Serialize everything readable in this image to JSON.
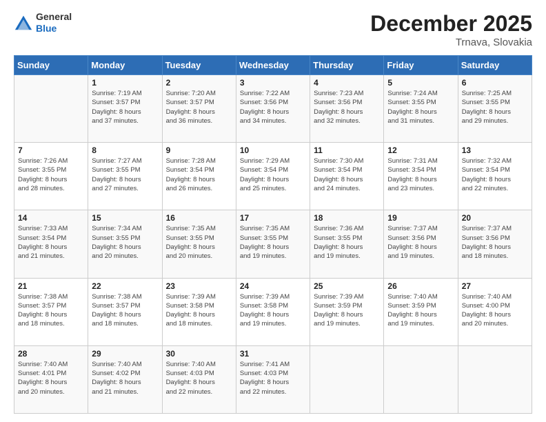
{
  "header": {
    "logo_general": "General",
    "logo_blue": "Blue",
    "month_year": "December 2025",
    "location": "Trnava, Slovakia"
  },
  "weekdays": [
    "Sunday",
    "Monday",
    "Tuesday",
    "Wednesday",
    "Thursday",
    "Friday",
    "Saturday"
  ],
  "weeks": [
    [
      {
        "day": "",
        "info": ""
      },
      {
        "day": "1",
        "info": "Sunrise: 7:19 AM\nSunset: 3:57 PM\nDaylight: 8 hours\nand 37 minutes."
      },
      {
        "day": "2",
        "info": "Sunrise: 7:20 AM\nSunset: 3:57 PM\nDaylight: 8 hours\nand 36 minutes."
      },
      {
        "day": "3",
        "info": "Sunrise: 7:22 AM\nSunset: 3:56 PM\nDaylight: 8 hours\nand 34 minutes."
      },
      {
        "day": "4",
        "info": "Sunrise: 7:23 AM\nSunset: 3:56 PM\nDaylight: 8 hours\nand 32 minutes."
      },
      {
        "day": "5",
        "info": "Sunrise: 7:24 AM\nSunset: 3:55 PM\nDaylight: 8 hours\nand 31 minutes."
      },
      {
        "day": "6",
        "info": "Sunrise: 7:25 AM\nSunset: 3:55 PM\nDaylight: 8 hours\nand 29 minutes."
      }
    ],
    [
      {
        "day": "7",
        "info": "Sunrise: 7:26 AM\nSunset: 3:55 PM\nDaylight: 8 hours\nand 28 minutes."
      },
      {
        "day": "8",
        "info": "Sunrise: 7:27 AM\nSunset: 3:55 PM\nDaylight: 8 hours\nand 27 minutes."
      },
      {
        "day": "9",
        "info": "Sunrise: 7:28 AM\nSunset: 3:54 PM\nDaylight: 8 hours\nand 26 minutes."
      },
      {
        "day": "10",
        "info": "Sunrise: 7:29 AM\nSunset: 3:54 PM\nDaylight: 8 hours\nand 25 minutes."
      },
      {
        "day": "11",
        "info": "Sunrise: 7:30 AM\nSunset: 3:54 PM\nDaylight: 8 hours\nand 24 minutes."
      },
      {
        "day": "12",
        "info": "Sunrise: 7:31 AM\nSunset: 3:54 PM\nDaylight: 8 hours\nand 23 minutes."
      },
      {
        "day": "13",
        "info": "Sunrise: 7:32 AM\nSunset: 3:54 PM\nDaylight: 8 hours\nand 22 minutes."
      }
    ],
    [
      {
        "day": "14",
        "info": "Sunrise: 7:33 AM\nSunset: 3:54 PM\nDaylight: 8 hours\nand 21 minutes."
      },
      {
        "day": "15",
        "info": "Sunrise: 7:34 AM\nSunset: 3:55 PM\nDaylight: 8 hours\nand 20 minutes."
      },
      {
        "day": "16",
        "info": "Sunrise: 7:35 AM\nSunset: 3:55 PM\nDaylight: 8 hours\nand 20 minutes."
      },
      {
        "day": "17",
        "info": "Sunrise: 7:35 AM\nSunset: 3:55 PM\nDaylight: 8 hours\nand 19 minutes."
      },
      {
        "day": "18",
        "info": "Sunrise: 7:36 AM\nSunset: 3:55 PM\nDaylight: 8 hours\nand 19 minutes."
      },
      {
        "day": "19",
        "info": "Sunrise: 7:37 AM\nSunset: 3:56 PM\nDaylight: 8 hours\nand 19 minutes."
      },
      {
        "day": "20",
        "info": "Sunrise: 7:37 AM\nSunset: 3:56 PM\nDaylight: 8 hours\nand 18 minutes."
      }
    ],
    [
      {
        "day": "21",
        "info": "Sunrise: 7:38 AM\nSunset: 3:57 PM\nDaylight: 8 hours\nand 18 minutes."
      },
      {
        "day": "22",
        "info": "Sunrise: 7:38 AM\nSunset: 3:57 PM\nDaylight: 8 hours\nand 18 minutes."
      },
      {
        "day": "23",
        "info": "Sunrise: 7:39 AM\nSunset: 3:58 PM\nDaylight: 8 hours\nand 18 minutes."
      },
      {
        "day": "24",
        "info": "Sunrise: 7:39 AM\nSunset: 3:58 PM\nDaylight: 8 hours\nand 19 minutes."
      },
      {
        "day": "25",
        "info": "Sunrise: 7:39 AM\nSunset: 3:59 PM\nDaylight: 8 hours\nand 19 minutes."
      },
      {
        "day": "26",
        "info": "Sunrise: 7:40 AM\nSunset: 3:59 PM\nDaylight: 8 hours\nand 19 minutes."
      },
      {
        "day": "27",
        "info": "Sunrise: 7:40 AM\nSunset: 4:00 PM\nDaylight: 8 hours\nand 20 minutes."
      }
    ],
    [
      {
        "day": "28",
        "info": "Sunrise: 7:40 AM\nSunset: 4:01 PM\nDaylight: 8 hours\nand 20 minutes."
      },
      {
        "day": "29",
        "info": "Sunrise: 7:40 AM\nSunset: 4:02 PM\nDaylight: 8 hours\nand 21 minutes."
      },
      {
        "day": "30",
        "info": "Sunrise: 7:40 AM\nSunset: 4:03 PM\nDaylight: 8 hours\nand 22 minutes."
      },
      {
        "day": "31",
        "info": "Sunrise: 7:41 AM\nSunset: 4:03 PM\nDaylight: 8 hours\nand 22 minutes."
      },
      {
        "day": "",
        "info": ""
      },
      {
        "day": "",
        "info": ""
      },
      {
        "day": "",
        "info": ""
      }
    ]
  ]
}
